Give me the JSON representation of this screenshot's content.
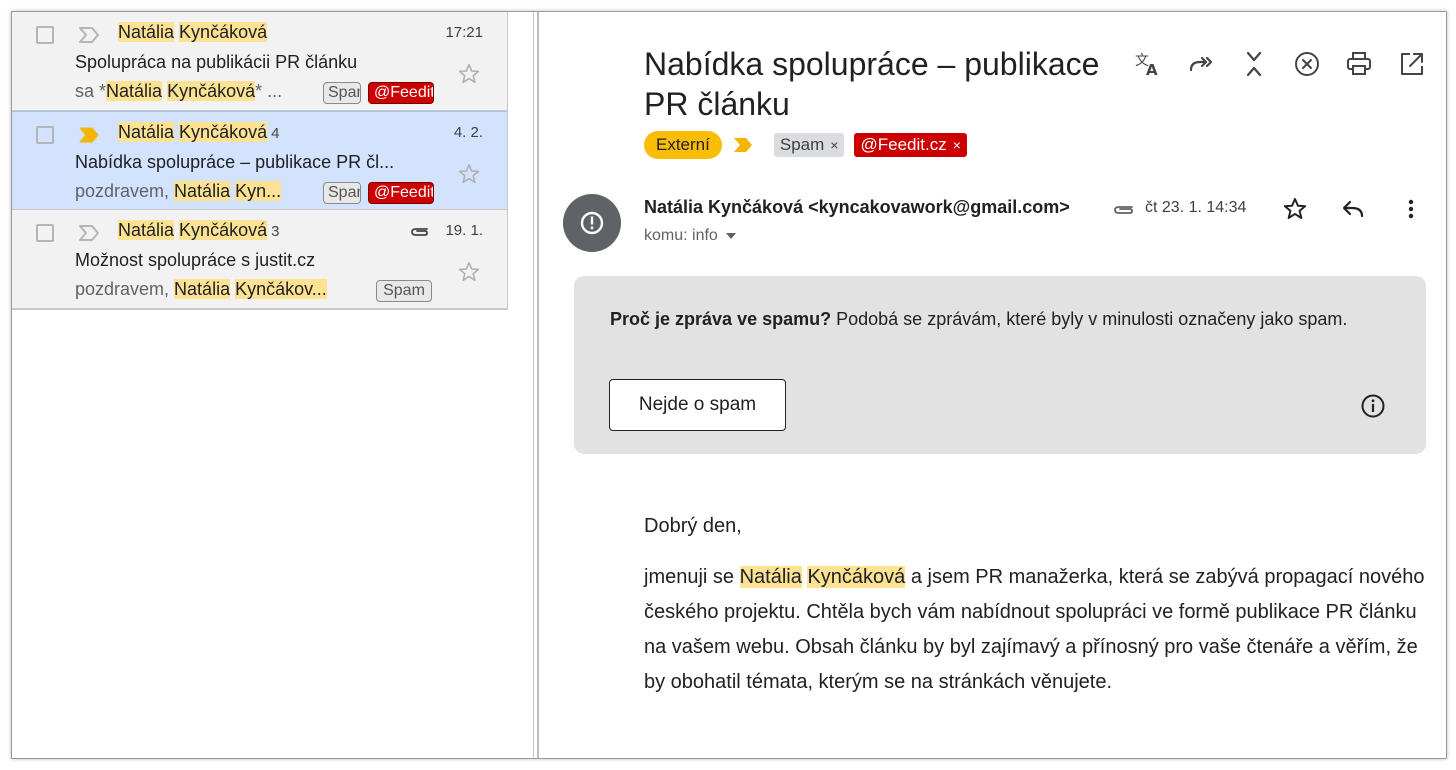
{
  "emails": [
    {
      "sender_first": "Natália",
      "sender_last": "Kynčáková",
      "count": "",
      "date": "17:21",
      "subject": "Spolupráca na publikácii PR článku",
      "snippet_prefix": "sa *",
      "snippet_first": "Natália",
      "snippet_last": "Kynčáková",
      "snippet_suffix": "* ...",
      "tags": [
        "Spam",
        "@Feedit"
      ]
    },
    {
      "sender_first": "Natália",
      "sender_last": "Kynčáková",
      "count": "4",
      "date": "4. 2.",
      "subject": "Nabídka spolupráce – publikace PR čl...",
      "snippet_prefix": "pozdravem, ",
      "snippet_first": "Natália",
      "snippet_last": "Kyn...",
      "snippet_suffix": "",
      "tags": [
        "Spam",
        "@Feedit"
      ]
    },
    {
      "sender_first": "Natália",
      "sender_last": "Kynčáková",
      "count": "3",
      "date": "19. 1.",
      "subject": "Možnost spolupráce s justit.cz",
      "snippet_prefix": "pozdravem, ",
      "snippet_first": "Natália",
      "snippet_last": "Kynčákov...",
      "snippet_suffix": "",
      "tags": [
        "Spam"
      ]
    }
  ],
  "message": {
    "title": "Nabídka spolupráce – publikace PR článku",
    "labels": {
      "external": "Externí",
      "spam": "Spam",
      "feedit": "@Feedit.cz",
      "remove_glyph": "×"
    },
    "from": "Natália Kynčáková <kyncakovawork@gmail.com>",
    "date": "čt 23. 1. 14:34",
    "to_prefix": "komu:",
    "to": "info",
    "spam_notice": {
      "question": "Proč je zpráva ve spamu?",
      "reason": "Podobá se zprávám, které byly v minulosti označeny jako spam.",
      "button": "Nejde o spam"
    },
    "greeting": "Dobrý den,",
    "body_prefix": "jmenuji se",
    "body_first": "Natália",
    "body_last": "Kynčáková",
    "body_suffix": "a jsem PR manažerka, která se zabývá propagací nového českého projektu. Chtěla bych vám nabídnout spolupráci ve formě publikace PR článku na vašem webu. Obsah článku by byl zajímavý a přínosný pro vaše čtenáře a věřím, že by obohatil témata, kterým se na stránkách věnujete."
  },
  "icons": {
    "toolbar": [
      "translate-icon",
      "forward-all-icon",
      "collapse-icon",
      "close-circle-icon",
      "print-icon",
      "open-new-window-icon"
    ],
    "header": [
      "star-icon",
      "reply-icon",
      "more-vert-icon"
    ]
  },
  "colors": {
    "highlight": "#fde293",
    "selected_row": "#d3e3fd",
    "external_label": "#fbbc04",
    "feedit_label": "#cc0000",
    "important_marker": "#f4b400"
  }
}
